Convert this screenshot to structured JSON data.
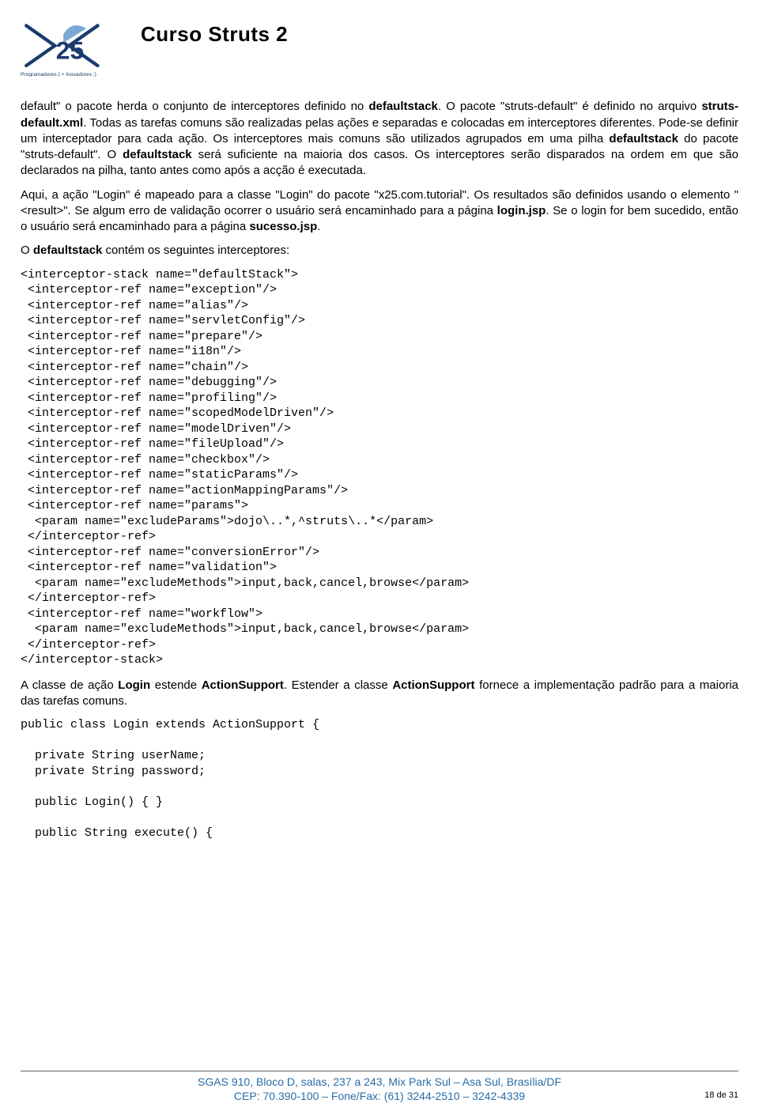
{
  "header": {
    "logo_tagline": "Programadores { + Inovadores ;}",
    "course_title": "Curso Struts 2"
  },
  "paragraphs": {
    "p1a": "default\" o pacote herda o conjunto de interceptores definido no ",
    "p1b": "defaultstack",
    "p1c": ". O pacote \"struts-default\" é definido no arquivo ",
    "p1d": "struts-default.xml",
    "p1e": ". Todas as tarefas comuns são realizadas pelas ações e separadas e colocadas em interceptores diferentes. Pode-se definir um interceptador para cada ação. Os interceptores mais comuns são utilizados agrupados em uma pilha ",
    "p1f": "defaultstack",
    "p1g": " do pacote \"struts-default\". O ",
    "p1h": "defaultstack",
    "p1i": " será suficiente na maioria dos casos. Os interceptores serão disparados na ordem em que são declarados na pilha, tanto antes como após a acção é executada.",
    "p2a": "Aqui, a ação \"Login\" é mapeado para a classe \"Login\" do pacote \"x25.com.tutorial\". Os resultados são definidos usando o elemento \"<result>\". Se algum erro de validação ocorrer o usuário será encaminhado para a página ",
    "p2b": "login.jsp",
    "p2c": ". Se o login for bem sucedido, então o usuário será encaminhado para a página ",
    "p2d": "sucesso.jsp",
    "p2e": ".",
    "p3a": "O ",
    "p3b": "defaultstack",
    "p3c": " contém os seguintes interceptores:",
    "p4a": "A classe de ação ",
    "p4b": "Login",
    "p4c": " estende ",
    "p4d": "ActionSupport",
    "p4e": ". Estender a classe ",
    "p4f": "ActionSupport",
    "p4g": " fornece a implementação padrão para a maioria das tarefas comuns."
  },
  "code1": "<interceptor-stack name=\"defaultStack\">\n <interceptor-ref name=\"exception\"/>\n <interceptor-ref name=\"alias\"/>\n <interceptor-ref name=\"servletConfig\"/>\n <interceptor-ref name=\"prepare\"/>\n <interceptor-ref name=\"i18n\"/>\n <interceptor-ref name=\"chain\"/>\n <interceptor-ref name=\"debugging\"/>\n <interceptor-ref name=\"profiling\"/>\n <interceptor-ref name=\"scopedModelDriven\"/>\n <interceptor-ref name=\"modelDriven\"/>\n <interceptor-ref name=\"fileUpload\"/>\n <interceptor-ref name=\"checkbox\"/>\n <interceptor-ref name=\"staticParams\"/>\n <interceptor-ref name=\"actionMappingParams\"/>\n <interceptor-ref name=\"params\">\n  <param name=\"excludeParams\">dojo\\..*,^struts\\..*</param>\n </interceptor-ref>\n <interceptor-ref name=\"conversionError\"/>\n <interceptor-ref name=\"validation\">\n  <param name=\"excludeMethods\">input,back,cancel,browse</param>\n </interceptor-ref>\n <interceptor-ref name=\"workflow\">\n  <param name=\"excludeMethods\">input,back,cancel,browse</param>\n </interceptor-ref>\n</interceptor-stack>",
  "code2": "public class Login extends ActionSupport {\n\n  private String userName;\n  private String password;\n\n  public Login() { }\n\n  public String execute() {",
  "footer": {
    "line1": "SGAS 910, Bloco D, salas, 237 a 243, Mix Park Sul – Asa Sul, Brasília/DF",
    "line2": "CEP: 70.390-100 – Fone/Fax: (61) 3244-2510 – 3242-4339",
    "page": "18 de 31"
  }
}
